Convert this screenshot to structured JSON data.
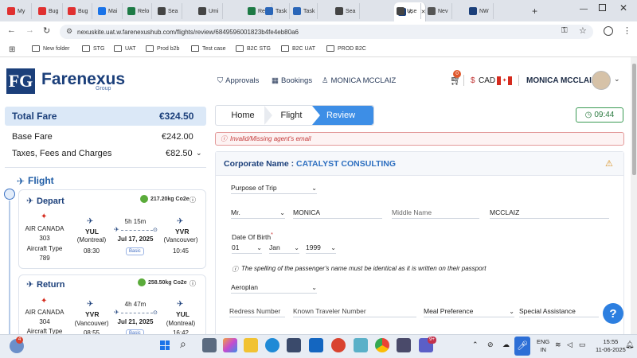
{
  "browser": {
    "tabs": [
      {
        "label": "My",
        "color": "#e03030"
      },
      {
        "label": "Bug",
        "color": "#e03030"
      },
      {
        "label": "Bug",
        "color": "#e03030"
      },
      {
        "label": "Mai",
        "color": "#1a73e8"
      },
      {
        "label": "Relo",
        "color": "#1d7a45"
      },
      {
        "label": "Sea",
        "color": "#444444"
      },
      {
        "label": "Umi",
        "color": "#444444"
      },
      {
        "label": "Relo",
        "color": "#1d7a45"
      },
      {
        "label": "Task",
        "color": "#2a66b8"
      },
      {
        "label": "Task",
        "color": "#2a66b8"
      },
      {
        "label": "Sea",
        "color": "#444444"
      },
      {
        "label": "K",
        "color": "#1b3f7a"
      },
      {
        "label": "Use",
        "color": "#444444"
      },
      {
        "label": "Nev",
        "color": "#555555"
      },
      {
        "label": "NW",
        "color": "#1b3f7a"
      }
    ],
    "url": "nexuskite.uat.w.farenexushub.com/flights/review/6849596001823b4fe4eb80a6",
    "bookmarks": [
      "New folder",
      "STG",
      "UAT",
      "Prod b2b",
      "Test case",
      "B2C STG",
      "B2C UAT",
      "PROD B2C"
    ]
  },
  "header": {
    "logo_mark": "FG",
    "logo_name": "Farenexus",
    "logo_sub": "Group",
    "approvals": "Approvals",
    "bookings": "Bookings",
    "user_link": "MONICA MCCLAIZ",
    "cart_count": "0",
    "currency_symbol": "$",
    "currency": "CAD",
    "user_name": "MONICA MCCLAIZ"
  },
  "fare": {
    "total_label": "Total Fare",
    "total_value": "€324.50",
    "base_label": "Base Fare",
    "base_value": "€242.00",
    "taxes_label": "Taxes, Fees and Charges",
    "taxes_value": "€82.50"
  },
  "flight": {
    "heading": "Flight",
    "depart": {
      "title": "Depart",
      "co2": "217.20kg Co2e",
      "airline": "AIR CANADA",
      "flight_no": "303",
      "aircraft_label": "Aircraft Type",
      "aircraft": "789",
      "from_code": "YUL",
      "from_city": "(Montreal)",
      "from_time": "08:30",
      "duration": "5h 15m",
      "date": "Jul 17, 2025",
      "fare_class": "Basic",
      "to_code": "YVR",
      "to_city": "(Vancouver)",
      "to_time": "10:45"
    },
    "return": {
      "title": "Return",
      "co2": "258.50kg Co2e",
      "airline": "AIR CANADA",
      "flight_no": "304",
      "aircraft_label": "Aircraft Type",
      "from_code": "YVR",
      "from_city": "(Vancouver)",
      "from_time": "08:55",
      "duration": "4h 47m",
      "date": "Jul 21, 2025",
      "fare_class": "Basic",
      "to_code": "YUL",
      "to_city": "(Montreal)",
      "to_time": "16:42"
    }
  },
  "breadcrumb": [
    "Home",
    "Flight",
    "Review"
  ],
  "timer": "09:44",
  "error": "Invalid/Missing agent's email",
  "form": {
    "corp_label": "Corporate Name :",
    "corp_value": "CATALYST CONSULTING",
    "purpose": "Purpose of Trip",
    "title": "Mr.",
    "first_name": "MONICA",
    "middle_placeholder": "Middle Name",
    "last_name": "MCCLAIZ",
    "dob_label": "Date Of Birth",
    "dob_day": "01",
    "dob_month": "Jan",
    "dob_year": "1999",
    "note": "The spelling of the passenger's name must be identical as it is written on their passport",
    "loyalty": "Aeroplan",
    "redress": "Redress Number",
    "ktn": "Known Traveler Number",
    "meal": "Meal Preference",
    "assistance": "Special Assistance"
  },
  "taskbar": {
    "weather_badge": "4",
    "lang": "ENG",
    "region": "IN",
    "time": "15:55",
    "date": "11-06-2025",
    "teams_badge": "9+"
  }
}
